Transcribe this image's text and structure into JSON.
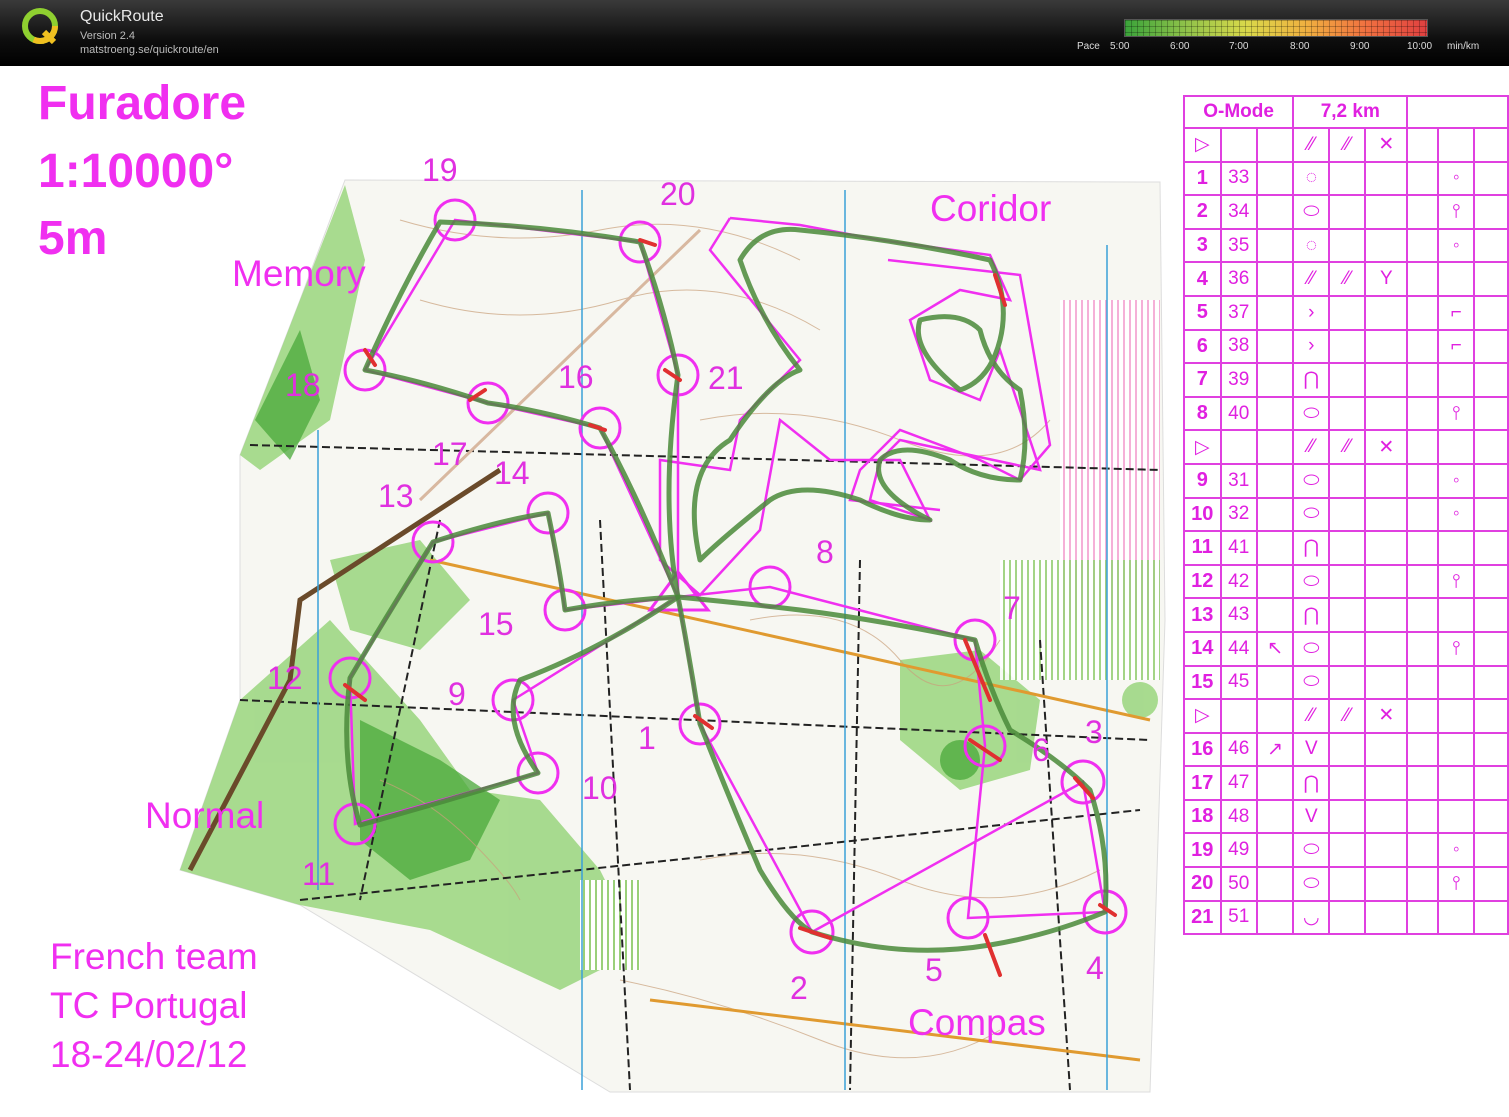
{
  "app": {
    "name": "QuickRoute",
    "version": "Version 2.4",
    "url": "matstroeng.se/quickroute/en",
    "pace_label": "Pace",
    "pace_ticks": [
      "5:00",
      "6:00",
      "7:00",
      "8:00",
      "9:00",
      "10:00"
    ],
    "pace_unit": "min/km"
  },
  "map": {
    "title_lines": [
      "Furadore",
      "1:10000°",
      "5m"
    ],
    "section_labels": [
      "Memory",
      "Coridor",
      "Normal",
      "Compas"
    ],
    "footer_lines": [
      "French team",
      "TC Portugal",
      "18-24/02/12"
    ],
    "control_numbers": [
      "1",
      "2",
      "3",
      "4",
      "5",
      "6",
      "7",
      "8",
      "9",
      "10",
      "11",
      "12",
      "13",
      "14",
      "15",
      "16",
      "17",
      "18",
      "19",
      "20",
      "21"
    ],
    "colors": {
      "course": "#f02ff0",
      "route_slow": "#e03030",
      "route_fast": "#4a8a3a"
    }
  },
  "descriptions": {
    "header": [
      "O-Mode",
      "7,2 km"
    ],
    "rows": [
      {
        "type": "start"
      },
      {
        "num": "1",
        "code": "33",
        "col3": "",
        "col4": "ring-dotted",
        "col8": "knoll-dot"
      },
      {
        "num": "2",
        "code": "34",
        "col3": "",
        "col4": "oval",
        "col8": "post-dot"
      },
      {
        "num": "3",
        "code": "35",
        "col3": "",
        "col4": "ring-dotted",
        "col8": "knoll-dot"
      },
      {
        "num": "4",
        "code": "36",
        "col3": "",
        "col4": "path-dash",
        "col5": "path-dash",
        "col6": "Y-junction"
      },
      {
        "num": "5",
        "code": "37",
        "col3": "",
        "col4": "chevron",
        "col8": "corner-dot"
      },
      {
        "num": "6",
        "code": "38",
        "col3": "",
        "col4": "chevron",
        "col8": "corner-dot"
      },
      {
        "num": "7",
        "code": "39",
        "col3": "",
        "col4": "bell",
        "col8": ""
      },
      {
        "num": "8",
        "code": "40",
        "col3": "",
        "col4": "oval",
        "col8": "post-dot"
      },
      {
        "type": "start"
      },
      {
        "num": "9",
        "code": "31",
        "col3": "",
        "col4": "oval",
        "col8": "knoll-dot"
      },
      {
        "num": "10",
        "code": "32",
        "col3": "",
        "col4": "oval",
        "col8": "knoll-dot"
      },
      {
        "num": "11",
        "code": "41",
        "col3": "",
        "col4": "bell",
        "col8": ""
      },
      {
        "num": "12",
        "code": "42",
        "col3": "",
        "col4": "oval",
        "col8": "post-dot"
      },
      {
        "num": "13",
        "code": "43",
        "col3": "",
        "col4": "bell",
        "col8": ""
      },
      {
        "num": "14",
        "code": "44",
        "col3": "↖",
        "col4": "oval",
        "col8": "post-dot"
      },
      {
        "num": "15",
        "code": "45",
        "col3": "",
        "col4": "oval",
        "col8": ""
      },
      {
        "type": "start"
      },
      {
        "num": "16",
        "code": "46",
        "col3": "↗",
        "col4": "V",
        "col8": ""
      },
      {
        "num": "17",
        "code": "47",
        "col3": "",
        "col4": "bell",
        "col8": ""
      },
      {
        "num": "18",
        "code": "48",
        "col3": "",
        "col4": "V",
        "col8": ""
      },
      {
        "num": "19",
        "code": "49",
        "col3": "",
        "col4": "oval",
        "col8": "knoll-dot"
      },
      {
        "num": "20",
        "code": "50",
        "col3": "",
        "col4": "oval",
        "col8": "post-dot"
      },
      {
        "num": "21",
        "code": "51",
        "col3": "",
        "col4": "cup",
        "col8": ""
      }
    ]
  }
}
